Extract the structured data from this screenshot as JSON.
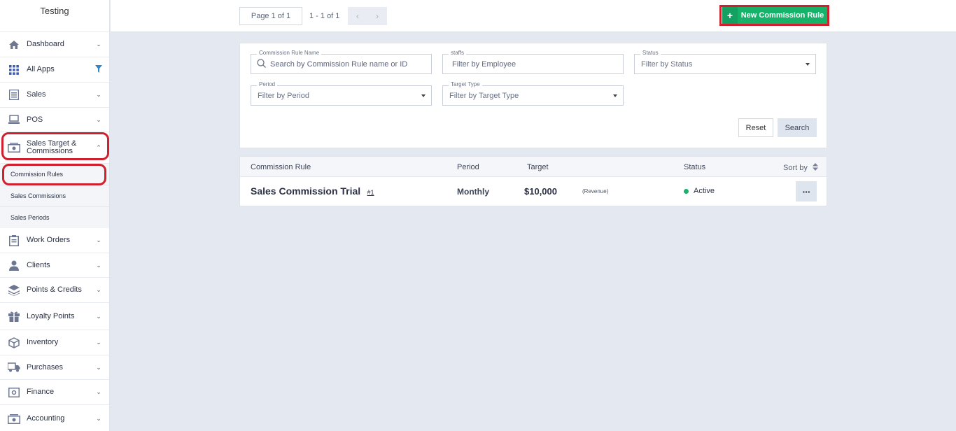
{
  "brand": {
    "name": "Testing"
  },
  "sidebar": {
    "items": [
      {
        "label": "Dashboard",
        "icon": "home-icon"
      },
      {
        "label": "All Apps",
        "icon": "grid-icon"
      },
      {
        "label": "Sales",
        "icon": "sales-icon"
      },
      {
        "label": "POS",
        "icon": "pos-icon"
      },
      {
        "label": "Sales Target & Commissions",
        "icon": "cash-icon"
      },
      {
        "label": "Work Orders",
        "icon": "clipboard-icon"
      },
      {
        "label": "Clients",
        "icon": "user-icon"
      },
      {
        "label": "Points & Credits",
        "icon": "layers-icon"
      },
      {
        "label": "Loyalty Points",
        "icon": "gift-icon"
      },
      {
        "label": "Inventory",
        "icon": "box-icon"
      },
      {
        "label": "Purchases",
        "icon": "truck-icon"
      },
      {
        "label": "Finance",
        "icon": "safe-icon"
      },
      {
        "label": "Accounting",
        "icon": "cash-icon"
      }
    ],
    "sub_items": [
      {
        "label": "Commission Rules"
      },
      {
        "label": "Sales Commissions"
      },
      {
        "label": "Sales Periods"
      }
    ]
  },
  "topbar": {
    "page_label": "Page 1 of 1",
    "range_label": "1 - 1 of 1",
    "new_button": "New Commission Rule"
  },
  "filters": {
    "rule_name": {
      "label": "Commission Rule Name",
      "placeholder": "Search by Commission Rule name or ID"
    },
    "staffs": {
      "label": "staffs",
      "placeholder": "Filter by Employee"
    },
    "status": {
      "label": "Status",
      "placeholder": "Filter by Status"
    },
    "period": {
      "label": "Period",
      "placeholder": "Filter by Period"
    },
    "target_type": {
      "label": "Target Type",
      "placeholder": "Filter by Target Type"
    },
    "reset": "Reset",
    "search": "Search"
  },
  "table": {
    "headers": {
      "rule": "Commission Rule",
      "period": "Period",
      "target": "Target",
      "status": "Status",
      "sort": "Sort by"
    },
    "rows": [
      {
        "name": "Sales Commission Trial",
        "id": "#1",
        "period": "Monthly",
        "target": "$10,000",
        "target_type": "(Revenue)",
        "status": "Active"
      }
    ]
  },
  "colors": {
    "accent_green": "#17b26a",
    "highlight_red": "#d0202d"
  }
}
